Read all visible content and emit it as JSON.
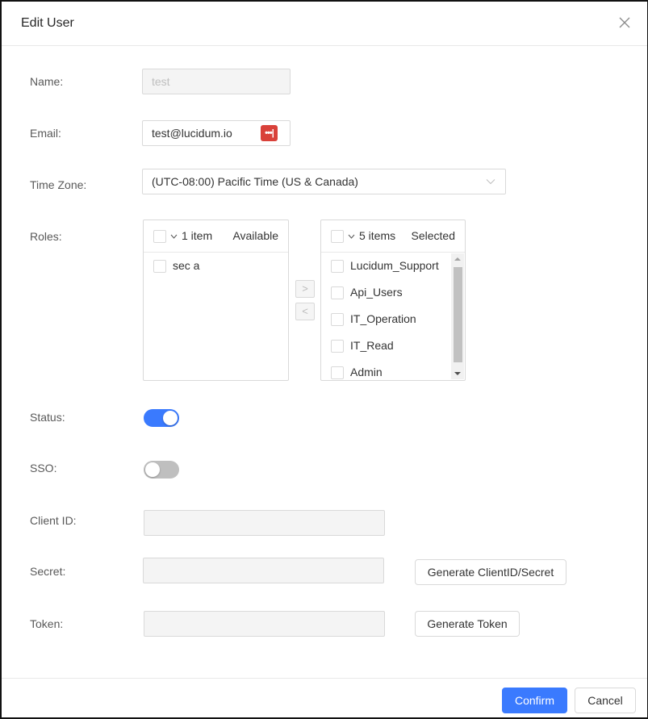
{
  "dialog": {
    "title": "Edit User",
    "close_icon": "close-icon"
  },
  "form": {
    "name": {
      "label": "Name:",
      "value": "test",
      "disabled": true
    },
    "email": {
      "label": "Email:",
      "value": "test@lucidum.io",
      "icon": "password-manager-icon",
      "icon_text": "•••|"
    },
    "timezone": {
      "label": "Time Zone:",
      "value": "(UTC-08:00) Pacific Time (US & Canada)"
    },
    "roles": {
      "label": "Roles:",
      "available": {
        "count": "1 item",
        "title": "Available",
        "items": [
          "sec a"
        ]
      },
      "selected": {
        "count": "5 items",
        "title": "Selected",
        "items": [
          "Lucidum_Support",
          "Api_Users",
          "IT_Operation",
          "IT_Read",
          "Admin"
        ]
      },
      "move_right_label": ">",
      "move_left_label": "<"
    },
    "status": {
      "label": "Status:",
      "on": true
    },
    "sso": {
      "label": "SSO:",
      "on": false
    },
    "client_id": {
      "label": "Client ID:",
      "value": ""
    },
    "secret": {
      "label": "Secret:",
      "value": ""
    },
    "token": {
      "label": "Token:",
      "value": ""
    },
    "generate_client_secret_label": "Generate ClientID/Secret",
    "generate_token_label": "Generate Token"
  },
  "footer": {
    "confirm_label": "Confirm",
    "cancel_label": "Cancel"
  },
  "colors": {
    "primary": "#3a7afe",
    "switch_off": "#bfbfbf",
    "password_icon": "#d9413a"
  }
}
